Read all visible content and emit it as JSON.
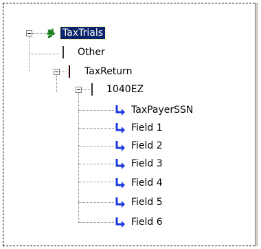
{
  "tree": {
    "root": {
      "label": "TaxTrials",
      "icon": "grapes-icon",
      "expanded": true,
      "selected": true
    },
    "children": [
      {
        "label": "Other",
        "icon": "document-icon"
      },
      {
        "label": "TaxReturn",
        "icon": "book-icon",
        "expanded": true,
        "children": [
          {
            "label": "1040EZ",
            "icon": "document-icon",
            "expanded": true,
            "fields": [
              {
                "label": "TaxPayerSSN",
                "icon": "arrow-icon"
              },
              {
                "label": "Field 1",
                "icon": "arrow-icon"
              },
              {
                "label": "Field 2",
                "icon": "arrow-icon"
              },
              {
                "label": "Field 3",
                "icon": "arrow-icon"
              },
              {
                "label": "Field 4",
                "icon": "arrow-icon"
              },
              {
                "label": "Field 5",
                "icon": "arrow-icon"
              },
              {
                "label": "Field 6",
                "icon": "arrow-icon"
              }
            ]
          }
        ]
      }
    ]
  },
  "colors": {
    "selection_bg": "#0a246a",
    "arrow_blue": "#1a3adf",
    "book_red": "#8b0000",
    "grapes_green": "#2e8b2e"
  }
}
